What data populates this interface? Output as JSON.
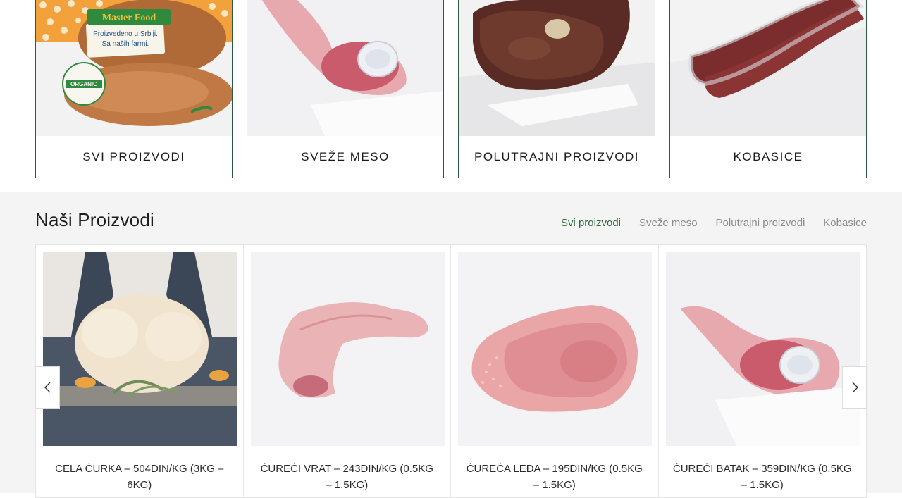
{
  "categories": [
    {
      "label": "SVI PROIZVODI",
      "image": "packaged-smoked-turkey",
      "package_text_1": "Master Food",
      "package_text_2": "Proizvedeno u Srbiji. Sa naših farmi.",
      "package_badge": "ORGANIC"
    },
    {
      "label": "SVEŽE MESO",
      "image": "fresh-turkey-leg"
    },
    {
      "label": "POLUTRAJNI PROIZVODI",
      "image": "smoked-ham"
    },
    {
      "label": "KOBASICE",
      "image": "vacuum-sausages"
    }
  ],
  "products_section": {
    "title": "Naši Proizvodi",
    "filters": [
      {
        "label": "Svi proizvodi",
        "active": true
      },
      {
        "label": "Sveže meso",
        "active": false
      },
      {
        "label": "Polutrajni proizvodi",
        "active": false
      },
      {
        "label": "Kobasice",
        "active": false
      }
    ],
    "products": [
      {
        "name": "CELA ĆURKA – 504DIN/KG (3KG – 6KG)",
        "image": "whole-turkey"
      },
      {
        "name": "ĆUREĆI VRAT – 243DIN/KG (0.5KG – 1.5KG)",
        "image": "turkey-neck"
      },
      {
        "name": "ĆUREĆA LEĐA – 195DIN/KG (0.5KG – 1.5KG)",
        "image": "turkey-back"
      },
      {
        "name": "ĆUREĆI BATAK – 359DIN/KG (0.5KG – 1.5KG)",
        "image": "turkey-drumstick"
      }
    ]
  },
  "colors": {
    "accent": "#2c6a3c",
    "card_border": "#2e5a3e",
    "section_bg": "#f4f4f4"
  },
  "icons": {
    "prev": "chevron-left-icon",
    "next": "chevron-right-icon"
  }
}
